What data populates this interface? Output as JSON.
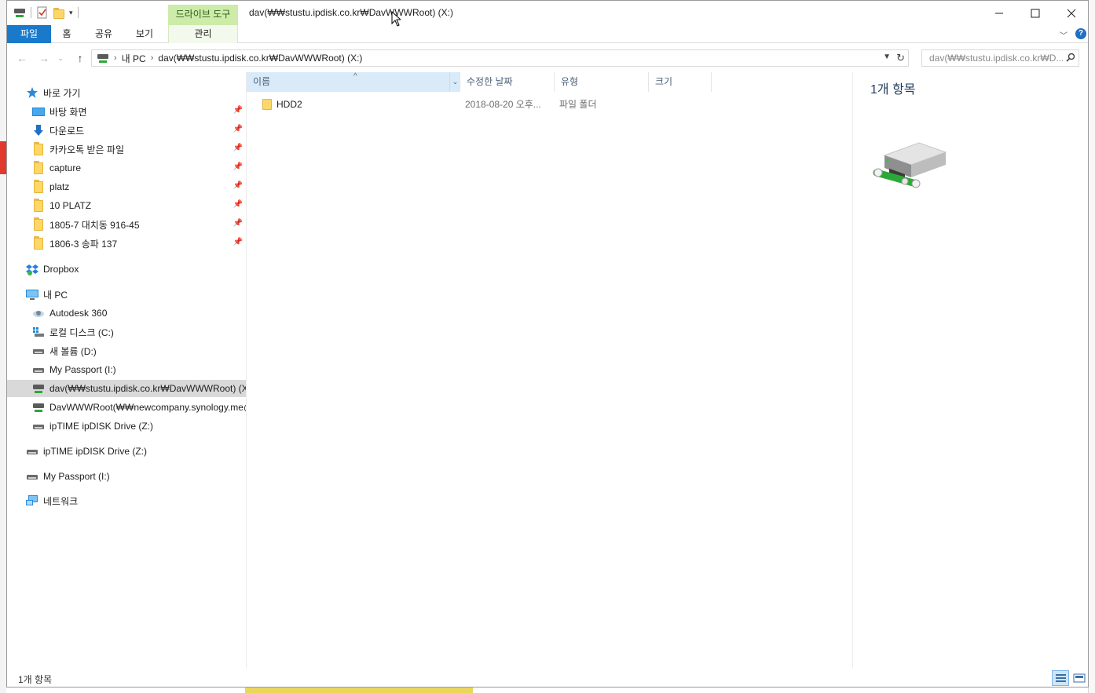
{
  "window": {
    "title": "dav(₩₩stustu.ipdisk.co.kr₩DavWWWRoot) (X:)",
    "context_group": "드라이브 도구"
  },
  "ribbon": {
    "tabs": [
      {
        "label": "파일"
      },
      {
        "label": "홈"
      },
      {
        "label": "공유"
      },
      {
        "label": "보기"
      },
      {
        "label": "관리"
      }
    ]
  },
  "address": {
    "crumbs": [
      "내 PC",
      "dav(₩₩stustu.ipdisk.co.kr₩DavWWWRoot) (X:)"
    ],
    "search_placeholder": "dav(₩₩stustu.ipdisk.co.kr₩D..."
  },
  "nav": {
    "quick_access": "바로 가기",
    "quick_items": [
      {
        "label": "바탕 화면",
        "icon": "desktop-icon"
      },
      {
        "label": "다운로드",
        "icon": "download-icon"
      },
      {
        "label": "카카오톡 받은 파일",
        "icon": "folder-icon"
      },
      {
        "label": "capture",
        "icon": "folder-icon"
      },
      {
        "label": "platz",
        "icon": "folder-icon"
      },
      {
        "label": "10 PLATZ",
        "icon": "folder-icon"
      },
      {
        "label": "1805-7 대치동 916-45",
        "icon": "folder-icon"
      },
      {
        "label": "1806-3 송파 137",
        "icon": "folder-icon"
      }
    ],
    "dropbox": "Dropbox",
    "this_pc": "내 PC",
    "pc_items": [
      {
        "label": "Autodesk 360",
        "icon": "autodesk-icon"
      },
      {
        "label": "로컬 디스크 (C:)",
        "icon": "windows-drive-icon"
      },
      {
        "label": "새 볼륨 (D:)",
        "icon": "drive-icon"
      },
      {
        "label": "My Passport (I:)",
        "icon": "drive-icon"
      },
      {
        "label": "dav(₩₩stustu.ipdisk.co.kr₩DavWWWRoot) (X:)",
        "icon": "network-drive-icon"
      },
      {
        "label": "DavWWWRoot(₩₩newcompany.synology.me@",
        "icon": "network-drive-icon"
      },
      {
        "label": "ipTIME ipDISK Drive (Z:)",
        "icon": "drive-icon"
      }
    ],
    "extra_items": [
      {
        "label": "ipTIME ipDISK Drive (Z:)",
        "icon": "drive-icon"
      },
      {
        "label": "My Passport (I:)",
        "icon": "drive-icon"
      }
    ],
    "network": "네트워크"
  },
  "columns": {
    "name": "이름",
    "date": "수정한 날짜",
    "type": "유형",
    "size": "크기"
  },
  "files": [
    {
      "name": "HDD2",
      "date": "2018-08-20 오후...",
      "type": "파일 폴더",
      "size": ""
    }
  ],
  "details": {
    "count": "1개 항목"
  },
  "status": {
    "count": "1개 항목"
  },
  "colors": {
    "file_tab": "#1979ca",
    "context_header": "#cdeba9",
    "selected_row": "#d9d9d9",
    "sorted_column": "#d9ebf9"
  }
}
